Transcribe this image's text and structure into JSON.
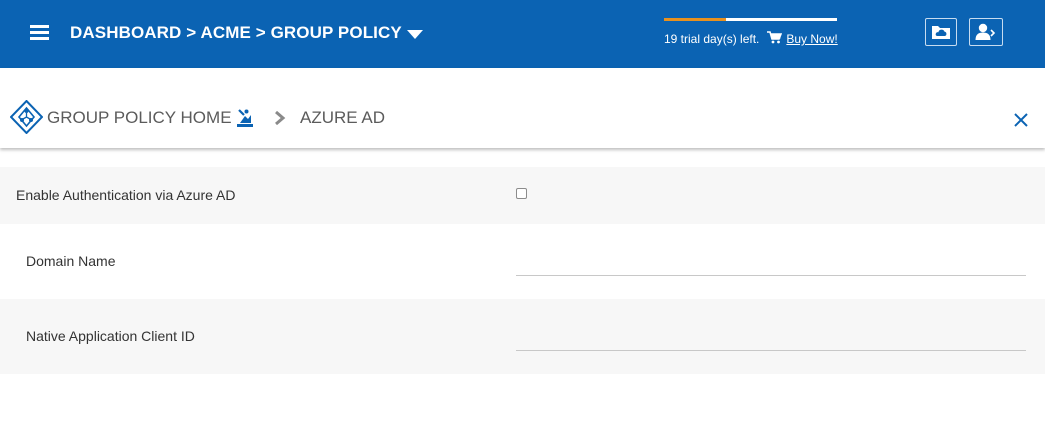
{
  "header": {
    "breadcrumb": "DASHBOARD > ACME > GROUP POLICY",
    "trial_text": "19 trial day(s) left.",
    "buy_now": "Buy Now!",
    "trial_progress_fraction": 0.36,
    "colors": {
      "bar_bg": "#0b63b3",
      "trial_accent": "#e8911f"
    },
    "icons": [
      "menu-icon",
      "caret-down-icon",
      "cart-icon",
      "folder-cloud-icon",
      "user-logout-icon"
    ]
  },
  "subheader": {
    "home_label": "GROUP POLICY HOME",
    "current_label": "AZURE AD",
    "icons": [
      "group-policy-icon",
      "run-policy-icon",
      "chevron-right-icon",
      "close-icon"
    ]
  },
  "form": {
    "enable_label": "Enable Authentication via Azure AD",
    "enable_checked": false,
    "domain_label": "Domain Name",
    "domain_value": "",
    "client_id_label": "Native Application Client ID",
    "client_id_value": ""
  }
}
